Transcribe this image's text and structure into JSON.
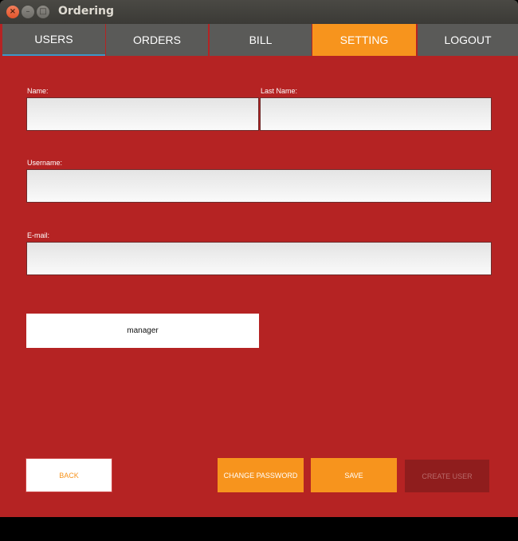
{
  "window": {
    "title": "Ordering",
    "buttons": {
      "close": "×",
      "minimize": "–",
      "maximize": "□"
    }
  },
  "tabs": [
    {
      "label": "USERS"
    },
    {
      "label": "ORDERS"
    },
    {
      "label": "BILL"
    },
    {
      "label": "SETTING"
    },
    {
      "label": "LOGOUT"
    }
  ],
  "form": {
    "name_label": "Name:",
    "last_name_label": "Last Name:",
    "username_label": "Username:",
    "email_label": "E-mail:",
    "name_value": "",
    "last_name_value": "",
    "username_value": "",
    "email_value": "",
    "role_value": "manager"
  },
  "actions": {
    "back": "BACK",
    "change_password": "CHANGE PASSWORD",
    "save": "SAVE",
    "create_user": "CREATE USER"
  },
  "colors": {
    "background": "#b52323",
    "tab": "#5a5a58",
    "accent": "#f7941d",
    "disabled": "#8f1d1d"
  }
}
